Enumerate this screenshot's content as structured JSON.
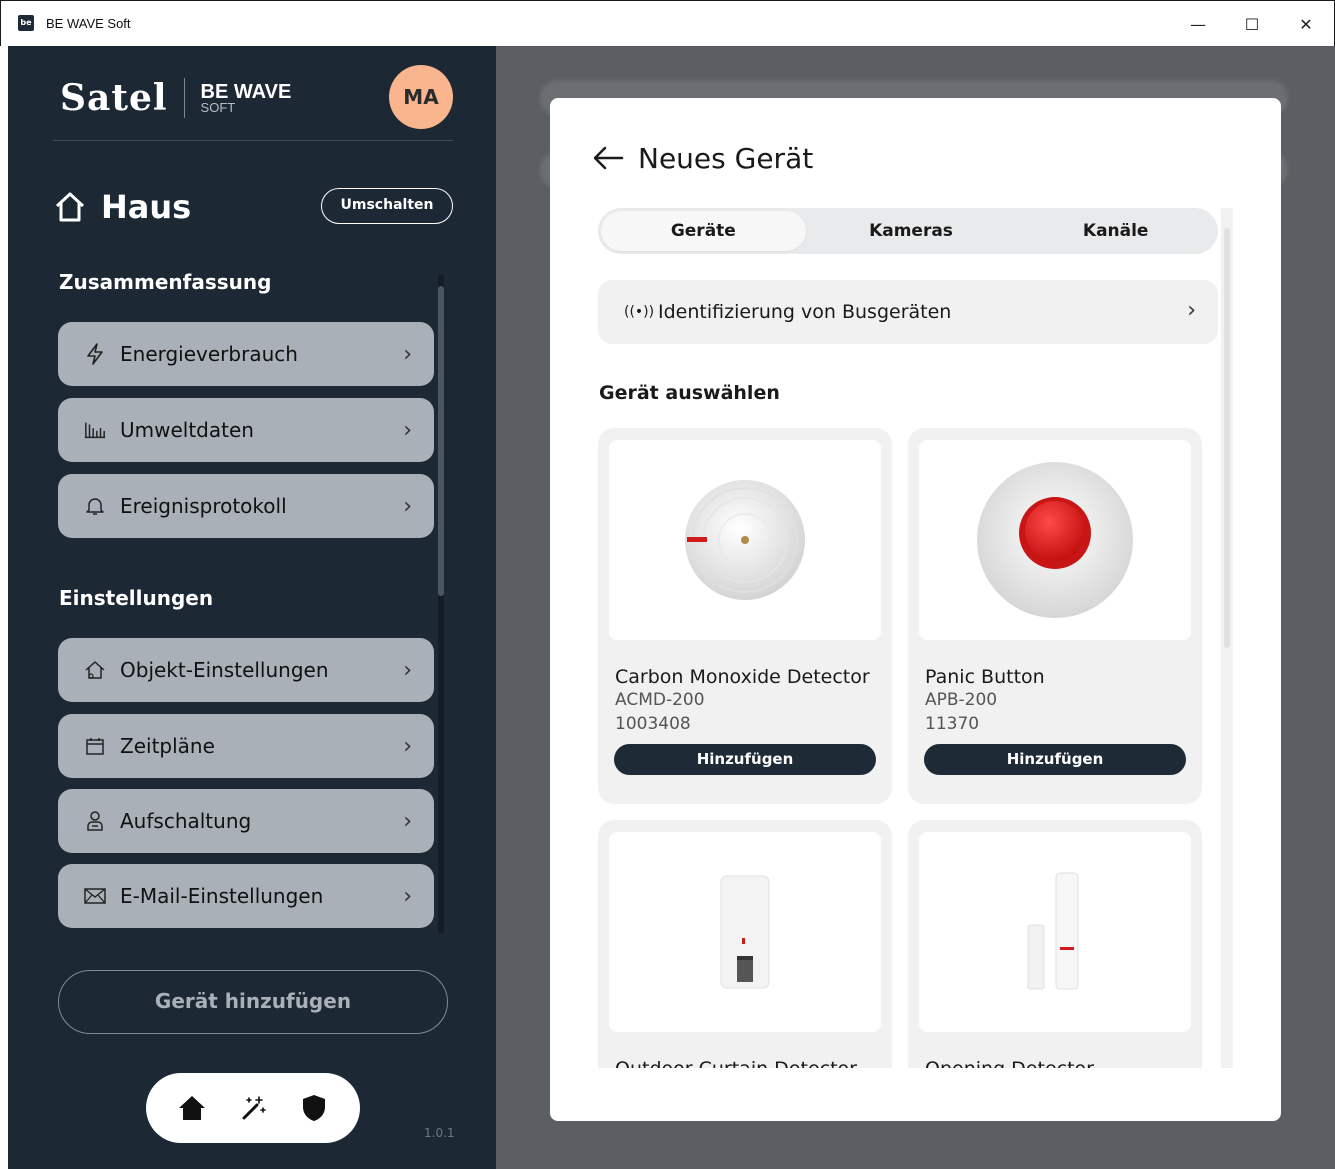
{
  "window": {
    "icon_text": "be",
    "title": "BE WAVE Soft",
    "minimize": "—",
    "maximize": "☐",
    "close": "✕"
  },
  "sidebar": {
    "brand_name": "Satel",
    "brand_product": "BE WAVE",
    "brand_product_sub": "SOFT",
    "avatar_initials": "MA",
    "home_title": "Haus",
    "switch_label": "Umschalten",
    "summary_title": "Zusammenfassung",
    "summary_items": [
      {
        "label": "Energieverbrauch",
        "icon": "lightning-icon"
      },
      {
        "label": "Umweltdaten",
        "icon": "bar-chart-icon"
      },
      {
        "label": "Ereignisprotokoll",
        "icon": "bell-icon"
      }
    ],
    "settings_title": "Einstellungen",
    "settings_items": [
      {
        "label": "Objekt-Einstellungen",
        "icon": "home-settings-icon"
      },
      {
        "label": "Zeitpläne",
        "icon": "calendar-icon"
      },
      {
        "label": "Aufschaltung",
        "icon": "agent-icon"
      },
      {
        "label": "E-Mail-Einstellungen",
        "icon": "envelope-icon"
      }
    ],
    "add_device_label": "Gerät hinzufügen",
    "version": "1.0.1"
  },
  "modal": {
    "title": "Neues Gerät",
    "tabs": [
      "Geräte",
      "Kameras",
      "Kanäle"
    ],
    "active_tab": "Geräte",
    "bus_identification_label": "Identifizierung von Busgeräten",
    "select_label": "Gerät auswählen",
    "devices": [
      {
        "name": "Carbon Monoxide Detector",
        "model": "ACMD-200",
        "code": "1003408",
        "button": "Hinzufügen"
      },
      {
        "name": "Panic Button",
        "model": "APB-200",
        "code": "11370",
        "button": "Hinzufügen"
      },
      {
        "name": "Outdoor Curtain Detector",
        "model": "",
        "code": "",
        "button": ""
      },
      {
        "name": "Opening Detector",
        "model": "",
        "code": "",
        "button": ""
      }
    ]
  },
  "colors": {
    "sidebar_bg": "#1c2833",
    "menu_item_bg": "#a9b0b7",
    "avatar_bg": "#f8b58e",
    "button_dark": "#1e2a36",
    "accent_red": "#e01b1b"
  }
}
